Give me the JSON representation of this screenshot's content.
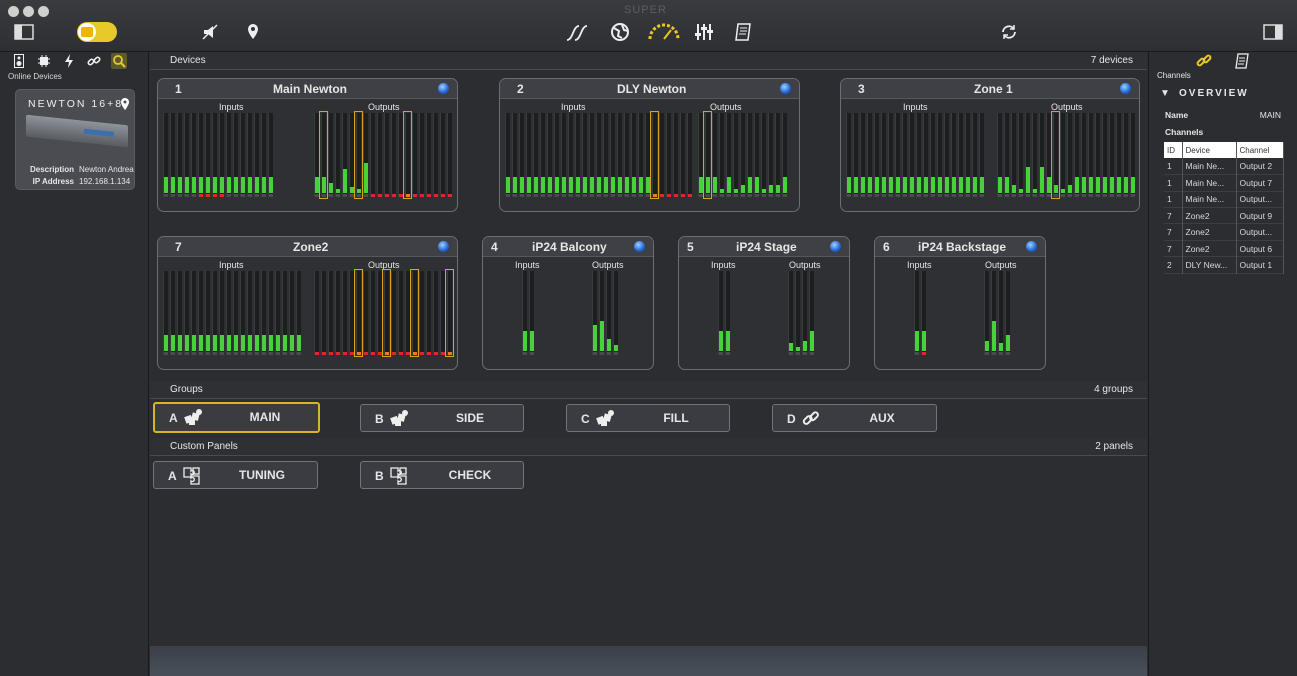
{
  "app": {
    "title": "SUPER"
  },
  "toolbar": {
    "icons": [
      "sidebar-toggle-icon",
      "power-toggle",
      "mute-icon",
      "location-icon",
      "connections-icon",
      "globe-icon",
      "gauge-icon",
      "mixer-icon",
      "document-icon",
      "refresh-icon",
      "right-sidebar-icon"
    ]
  },
  "left": {
    "tabs": [
      "speaker-icon",
      "chip-icon",
      "lightning-icon",
      "link-icon",
      "search-icon"
    ],
    "online_label": "Online Devices",
    "device": {
      "name": "NEWTON 16+8",
      "desc_label": "Description",
      "desc_value": "Newton Andrea",
      "ip_label": "IP Address",
      "ip_value": "192.168.1.134"
    }
  },
  "devices_section": {
    "title": "Devices",
    "count": "7 devices"
  },
  "devices": [
    {
      "id": "1",
      "name": "Main Newton",
      "inputs_label": "Inputs",
      "outputs_label": "Outputs"
    },
    {
      "id": "2",
      "name": "DLY Newton",
      "inputs_label": "Inputs",
      "outputs_label": "Outputs"
    },
    {
      "id": "3",
      "name": "Zone 1",
      "inputs_label": "Inputs",
      "outputs_label": "Outputs"
    },
    {
      "id": "7",
      "name": "Zone2",
      "inputs_label": "Inputs",
      "outputs_label": "Outputs"
    },
    {
      "id": "4",
      "name": "iP24  Balcony",
      "inputs_label": "Inputs",
      "outputs_label": "Outputs"
    },
    {
      "id": "5",
      "name": "iP24 Stage",
      "inputs_label": "Inputs",
      "outputs_label": "Outputs"
    },
    {
      "id": "6",
      "name": "iP24 Backstage",
      "inputs_label": "Inputs",
      "outputs_label": "Outputs"
    }
  ],
  "groups_section": {
    "title": "Groups",
    "count": "4 groups"
  },
  "groups": [
    {
      "letter": "A",
      "label": "MAIN",
      "icon": "cubes-icon"
    },
    {
      "letter": "B",
      "label": "SIDE",
      "icon": "cubes-icon"
    },
    {
      "letter": "C",
      "label": "FILL",
      "icon": "cubes-icon"
    },
    {
      "letter": "D",
      "label": "AUX",
      "icon": "link-icon"
    }
  ],
  "panels_section": {
    "title": "Custom Panels",
    "count": "2 panels"
  },
  "panels": [
    {
      "letter": "A",
      "label": "TUNING",
      "icon": "puzzle-icon"
    },
    {
      "letter": "B",
      "label": "CHECK",
      "icon": "puzzle-icon"
    }
  ],
  "right": {
    "tabs": [
      "link-icon",
      "document-icon"
    ],
    "channels_label": "Channels",
    "overview": "OVERVIEW",
    "name_label": "Name",
    "name_value": "MAIN",
    "channels_title": "Channels",
    "table_headers": [
      "ID",
      "Device",
      "Channel"
    ],
    "rows": [
      [
        "1",
        "Main Ne...",
        "Output 2"
      ],
      [
        "1",
        "Main Ne...",
        "Output 7"
      ],
      [
        "1",
        "Main Ne...",
        "Output..."
      ],
      [
        "7",
        "Zone2",
        "Output 9"
      ],
      [
        "7",
        "Zone2",
        "Output..."
      ],
      [
        "7",
        "Zone2",
        "Output 6"
      ],
      [
        "2",
        "DLY New...",
        "Output 1"
      ]
    ]
  }
}
